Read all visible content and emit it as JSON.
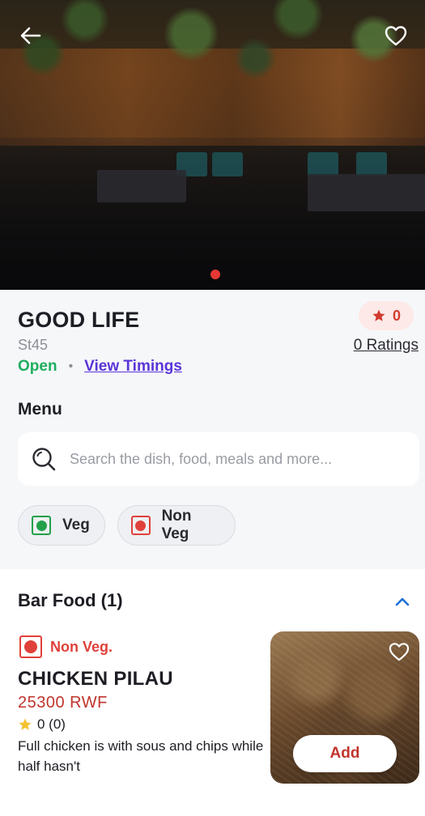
{
  "hero": {
    "back_icon": "arrow-left-icon",
    "favorite_icon": "heart-outline-icon",
    "carousel_active_color": "#e53935"
  },
  "restaurant": {
    "name": "GOOD LIFE",
    "code": "St45",
    "status": "Open",
    "separator": "•",
    "timings_link": "View Timings",
    "rating_value": "0",
    "rating_icon": "star-icon",
    "ratings_link": "0 Ratings"
  },
  "menu": {
    "title": "Menu",
    "search": {
      "icon": "search-icon",
      "placeholder": "Search the dish, food, meals and more...",
      "value": ""
    },
    "filters": [
      {
        "label": "Veg",
        "icon": "veg-mark-icon",
        "color": "#22a04a"
      },
      {
        "label": "Non Veg",
        "icon": "nonveg-mark-icon",
        "color": "#e0413b"
      }
    ]
  },
  "category": {
    "title": "Bar Food (1)",
    "toggle_icon": "chevron-up-icon",
    "items": [
      {
        "type": "Non Veg.",
        "name": "CHICKEN PILAU",
        "price": "25300 RWF",
        "rating": "0 (0)",
        "description": "Full chicken is with sous and chips while half hasn't",
        "add_label": "Add",
        "favorite_icon": "heart-outline-icon"
      }
    ]
  },
  "colors": {
    "accent_red": "#e0413b",
    "open_green": "#1fae5f",
    "link_purple": "#5a35d8",
    "price_red": "#c0352d"
  }
}
